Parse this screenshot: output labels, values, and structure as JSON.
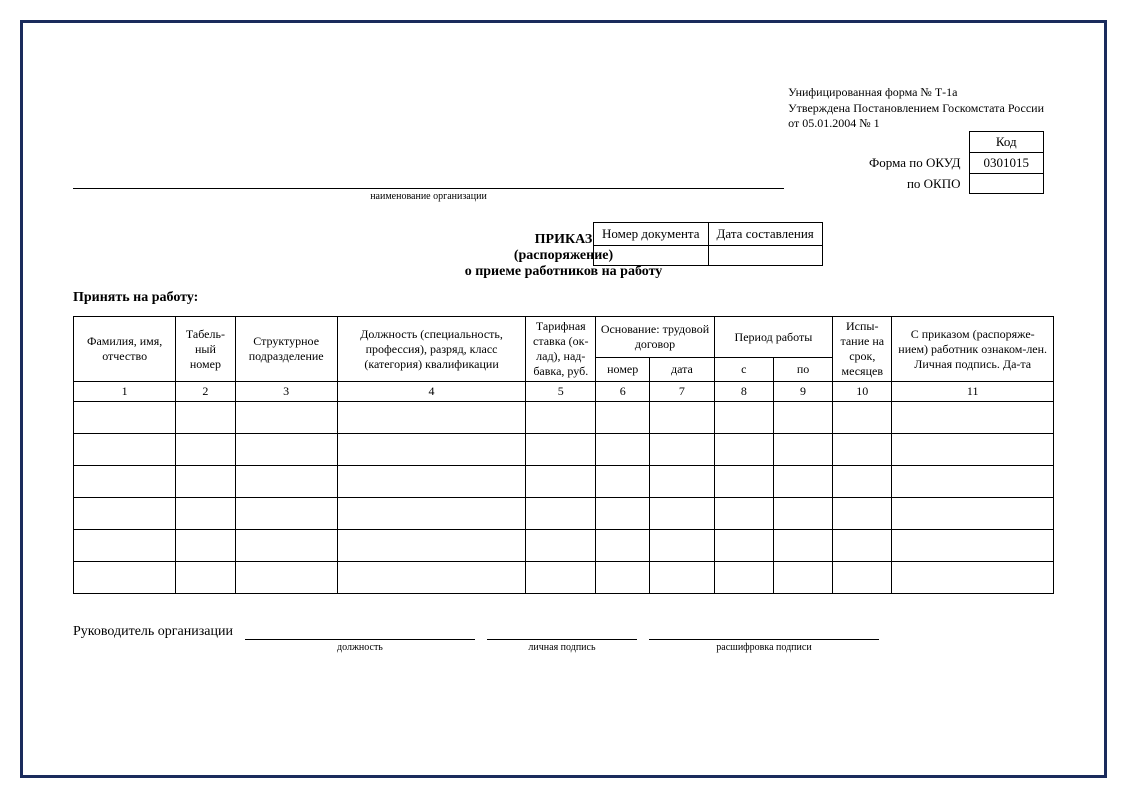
{
  "form_info": {
    "line1": "Унифицированная форма № Т-1а",
    "line2": "Утверждена Постановлением Госкомстата России",
    "line3": "от 05.01.2004 № 1"
  },
  "codes": {
    "code_header": "Код",
    "okud_label": "Форма по ОКУД",
    "okud_value": "0301015",
    "okpo_label": "по ОКПО",
    "okpo_value": ""
  },
  "org_caption": "наименование организации",
  "doc_number": {
    "num_header": "Номер документа",
    "date_header": "Дата составления",
    "num_value": "",
    "date_value": ""
  },
  "title": {
    "main": "ПРИКАЗ",
    "sub1": "(распоряжение)",
    "sub2": "о приеме работников на работу"
  },
  "accept": "Принять на работу:",
  "headers": {
    "col1": "Фамилия, имя, отчество",
    "col2": "Табель-ный номер",
    "col3": "Структурное подразделение",
    "col4": "Должность (специальность, профессия), разряд, класс (категория) квалификации",
    "col5": "Тарифная ставка (ок-лад), над-бавка, руб.",
    "group6": "Основание: трудовой договор",
    "col6": "номер",
    "col7": "дата",
    "group8": "Период работы",
    "col8": "с",
    "col9": "по",
    "col10": "Испы-тание на срок, месяцев",
    "col11": "С приказом (распоряже-нием) работник ознаком-лен. Личная подпись. Да-та"
  },
  "numrow": [
    "1",
    "2",
    "3",
    "4",
    "5",
    "6",
    "7",
    "8",
    "9",
    "10",
    "11"
  ],
  "signature": {
    "leader": "Руководитель организации",
    "position": "должность",
    "personal": "личная подпись",
    "decoding": "расшифровка подписи"
  }
}
